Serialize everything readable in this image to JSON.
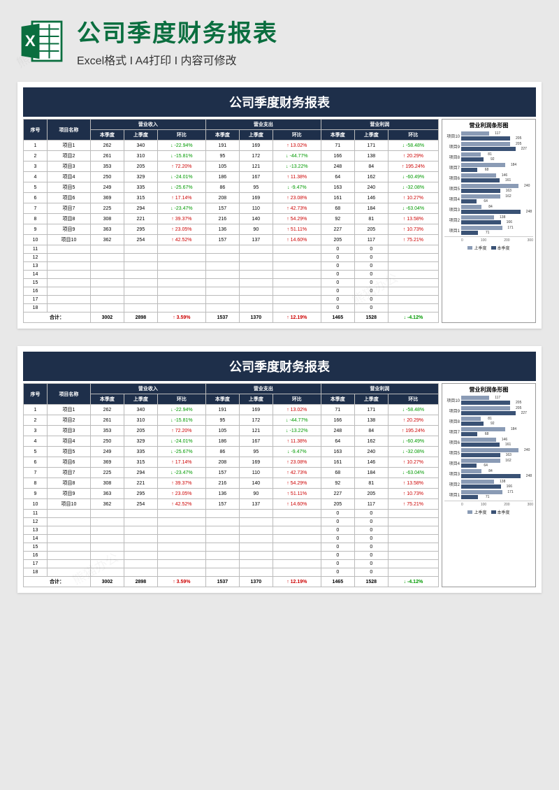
{
  "header": {
    "main_title": "公司季度财务报表",
    "sub_title": "Excel格式 I A4打印 I 内容可修改"
  },
  "sheet": {
    "title": "公司季度财务报表",
    "columns": {
      "seq": "序号",
      "name": "项目名称",
      "group_revenue": "营业收入",
      "group_expense": "营业支出",
      "group_profit": "营业利润",
      "curr": "本季度",
      "prev": "上季度",
      "change": "环比"
    },
    "rows": [
      {
        "seq": "1",
        "name": "项目1",
        "rev_c": 262,
        "rev_p": 340,
        "rev_ch": "-22.94%",
        "rev_dir": "down",
        "exp_c": 191,
        "exp_p": 169,
        "exp_ch": "13.02%",
        "exp_dir": "up",
        "pro_c": 71,
        "pro_p": 171,
        "pro_ch": "-58.48%",
        "pro_dir": "down"
      },
      {
        "seq": "2",
        "name": "项目2",
        "rev_c": 261,
        "rev_p": 310,
        "rev_ch": "-15.81%",
        "rev_dir": "down",
        "exp_c": 95,
        "exp_p": 172,
        "exp_ch": "-44.77%",
        "exp_dir": "down",
        "pro_c": 166,
        "pro_p": 138,
        "pro_ch": "20.29%",
        "pro_dir": "up"
      },
      {
        "seq": "3",
        "name": "项目3",
        "rev_c": 353,
        "rev_p": 205,
        "rev_ch": "72.20%",
        "rev_dir": "up",
        "exp_c": 105,
        "exp_p": 121,
        "exp_ch": "-13.22%",
        "exp_dir": "down",
        "pro_c": 248,
        "pro_p": 84,
        "pro_ch": "195.24%",
        "pro_dir": "up"
      },
      {
        "seq": "4",
        "name": "项目4",
        "rev_c": 250,
        "rev_p": 329,
        "rev_ch": "-24.01%",
        "rev_dir": "down",
        "exp_c": 186,
        "exp_p": 167,
        "exp_ch": "11.38%",
        "exp_dir": "up",
        "pro_c": 64,
        "pro_p": 162,
        "pro_ch": "-60.49%",
        "pro_dir": "down"
      },
      {
        "seq": "5",
        "name": "项目5",
        "rev_c": 249,
        "rev_p": 335,
        "rev_ch": "-25.67%",
        "rev_dir": "down",
        "exp_c": 86,
        "exp_p": 95,
        "exp_ch": "-9.47%",
        "exp_dir": "down",
        "pro_c": 163,
        "pro_p": 240,
        "pro_ch": "-32.08%",
        "pro_dir": "down"
      },
      {
        "seq": "6",
        "name": "项目6",
        "rev_c": 369,
        "rev_p": 315,
        "rev_ch": "17.14%",
        "rev_dir": "up",
        "exp_c": 208,
        "exp_p": 169,
        "exp_ch": "23.08%",
        "exp_dir": "up",
        "pro_c": 161,
        "pro_p": 146,
        "pro_ch": "10.27%",
        "pro_dir": "up"
      },
      {
        "seq": "7",
        "name": "项目7",
        "rev_c": 225,
        "rev_p": 294,
        "rev_ch": "-23.47%",
        "rev_dir": "down",
        "exp_c": 157,
        "exp_p": 110,
        "exp_ch": "42.73%",
        "exp_dir": "up",
        "pro_c": 68,
        "pro_p": 184,
        "pro_ch": "-63.04%",
        "pro_dir": "down"
      },
      {
        "seq": "8",
        "name": "项目8",
        "rev_c": 308,
        "rev_p": 221,
        "rev_ch": "39.37%",
        "rev_dir": "up",
        "exp_c": 216,
        "exp_p": 140,
        "exp_ch": "54.29%",
        "exp_dir": "up",
        "pro_c": 92,
        "pro_p": 81,
        "pro_ch": "13.58%",
        "pro_dir": "up"
      },
      {
        "seq": "9",
        "name": "项目9",
        "rev_c": 363,
        "rev_p": 295,
        "rev_ch": "23.05%",
        "rev_dir": "up",
        "exp_c": 136,
        "exp_p": 90,
        "exp_ch": "51.11%",
        "exp_dir": "up",
        "pro_c": 227,
        "pro_p": 205,
        "pro_ch": "10.73%",
        "pro_dir": "up"
      },
      {
        "seq": "10",
        "name": "项目10",
        "rev_c": 362,
        "rev_p": 254,
        "rev_ch": "42.52%",
        "rev_dir": "up",
        "exp_c": 157,
        "exp_p": 137,
        "exp_ch": "14.60%",
        "exp_dir": "up",
        "pro_c": 205,
        "pro_p": 117,
        "pro_ch": "75.21%",
        "pro_dir": "up"
      },
      {
        "seq": "11",
        "name": "",
        "rev_c": "",
        "rev_p": "",
        "rev_ch": "",
        "rev_dir": "",
        "exp_c": "",
        "exp_p": "",
        "exp_ch": "",
        "exp_dir": "",
        "pro_c": 0,
        "pro_p": 0,
        "pro_ch": "",
        "pro_dir": ""
      },
      {
        "seq": "12",
        "name": "",
        "rev_c": "",
        "rev_p": "",
        "rev_ch": "",
        "rev_dir": "",
        "exp_c": "",
        "exp_p": "",
        "exp_ch": "",
        "exp_dir": "",
        "pro_c": 0,
        "pro_p": 0,
        "pro_ch": "",
        "pro_dir": ""
      },
      {
        "seq": "13",
        "name": "",
        "rev_c": "",
        "rev_p": "",
        "rev_ch": "",
        "rev_dir": "",
        "exp_c": "",
        "exp_p": "",
        "exp_ch": "",
        "exp_dir": "",
        "pro_c": 0,
        "pro_p": 0,
        "pro_ch": "",
        "pro_dir": ""
      },
      {
        "seq": "14",
        "name": "",
        "rev_c": "",
        "rev_p": "",
        "rev_ch": "",
        "rev_dir": "",
        "exp_c": "",
        "exp_p": "",
        "exp_ch": "",
        "exp_dir": "",
        "pro_c": 0,
        "pro_p": 0,
        "pro_ch": "",
        "pro_dir": ""
      },
      {
        "seq": "15",
        "name": "",
        "rev_c": "",
        "rev_p": "",
        "rev_ch": "",
        "rev_dir": "",
        "exp_c": "",
        "exp_p": "",
        "exp_ch": "",
        "exp_dir": "",
        "pro_c": 0,
        "pro_p": 0,
        "pro_ch": "",
        "pro_dir": ""
      },
      {
        "seq": "16",
        "name": "",
        "rev_c": "",
        "rev_p": "",
        "rev_ch": "",
        "rev_dir": "",
        "exp_c": "",
        "exp_p": "",
        "exp_ch": "",
        "exp_dir": "",
        "pro_c": 0,
        "pro_p": 0,
        "pro_ch": "",
        "pro_dir": ""
      },
      {
        "seq": "17",
        "name": "",
        "rev_c": "",
        "rev_p": "",
        "rev_ch": "",
        "rev_dir": "",
        "exp_c": "",
        "exp_p": "",
        "exp_ch": "",
        "exp_dir": "",
        "pro_c": 0,
        "pro_p": 0,
        "pro_ch": "",
        "pro_dir": ""
      },
      {
        "seq": "18",
        "name": "",
        "rev_c": "",
        "rev_p": "",
        "rev_ch": "",
        "rev_dir": "",
        "exp_c": "",
        "exp_p": "",
        "exp_ch": "",
        "exp_dir": "",
        "pro_c": 0,
        "pro_p": 0,
        "pro_ch": "",
        "pro_dir": ""
      }
    ],
    "totals": {
      "label": "合计：",
      "rev_c": 3002,
      "rev_p": 2898,
      "rev_ch": "3.59%",
      "rev_dir": "up",
      "exp_c": 1537,
      "exp_p": 1370,
      "exp_ch": "12.19%",
      "exp_dir": "up",
      "pro_c": 1465,
      "pro_p": 1528,
      "pro_ch": "-4.12%",
      "pro_dir": "down"
    }
  },
  "chart_data": {
    "type": "bar",
    "title": "营业利润条形图",
    "categories": [
      "项目10",
      "项目9",
      "项目8",
      "项目7",
      "项目6",
      "项目5",
      "项目4",
      "项目3",
      "项目2",
      "项目1"
    ],
    "series": [
      {
        "name": "上季度",
        "values": [
          117,
          205,
          81,
          184,
          146,
          240,
          162,
          84,
          138,
          171
        ]
      },
      {
        "name": "本季度",
        "values": [
          205,
          227,
          92,
          68,
          161,
          163,
          64,
          248,
          166,
          71
        ]
      }
    ],
    "xlabel": "",
    "ylabel": "",
    "xlim": [
      0,
      300
    ],
    "ticks": [
      0,
      100,
      200,
      300
    ],
    "legend": [
      "上季度",
      "本季度"
    ]
  }
}
